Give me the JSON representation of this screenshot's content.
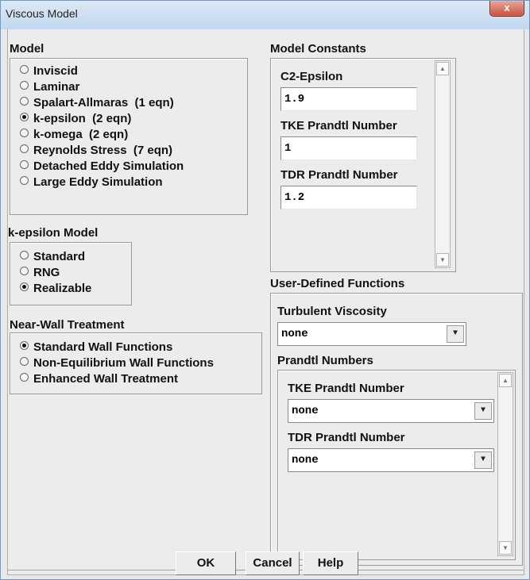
{
  "window": {
    "title": "Viscous Model",
    "close_glyph": "x"
  },
  "model": {
    "label": "Model",
    "options": [
      "Inviscid",
      "Laminar",
      "Spalart-Allmaras  (1 eqn)",
      "k-epsilon  (2 eqn)",
      "k-omega  (2 eqn)",
      "Reynolds Stress  (7 eqn)",
      "Detached Eddy Simulation",
      "Large Eddy Simulation"
    ],
    "selected": "k-epsilon  (2 eqn)"
  },
  "kepsilon_model": {
    "label": "k-epsilon Model",
    "options": [
      "Standard",
      "RNG",
      "Realizable"
    ],
    "selected": "Realizable"
  },
  "near_wall": {
    "label": "Near-Wall Treatment",
    "options": [
      "Standard Wall Functions",
      "Non-Equilibrium Wall Functions",
      "Enhanced Wall Treatment"
    ],
    "selected": "Standard Wall Functions"
  },
  "constants": {
    "label": "Model Constants",
    "items": [
      {
        "label": "C2-Epsilon",
        "value": "1.9"
      },
      {
        "label": "TKE Prandtl Number",
        "value": "1"
      },
      {
        "label": "TDR Prandtl Number",
        "value": "1.2"
      }
    ]
  },
  "udf": {
    "label": "User-Defined Functions",
    "turbulent_viscosity": {
      "label": "Turbulent Viscosity",
      "value": "none"
    },
    "prandtl": {
      "label": "Prandtl Numbers",
      "tke": {
        "label": "TKE Prandtl Number",
        "value": "none"
      },
      "tdr": {
        "label": "TDR Prandtl Number",
        "value": "none"
      }
    }
  },
  "buttons": {
    "ok": "OK",
    "cancel": "Cancel",
    "help": "Help"
  },
  "icons": {
    "dropdown": "chevron-down-icon",
    "scroll_up": "scroll-up-icon",
    "scroll_down": "scroll-down-icon",
    "close": "close-icon"
  }
}
